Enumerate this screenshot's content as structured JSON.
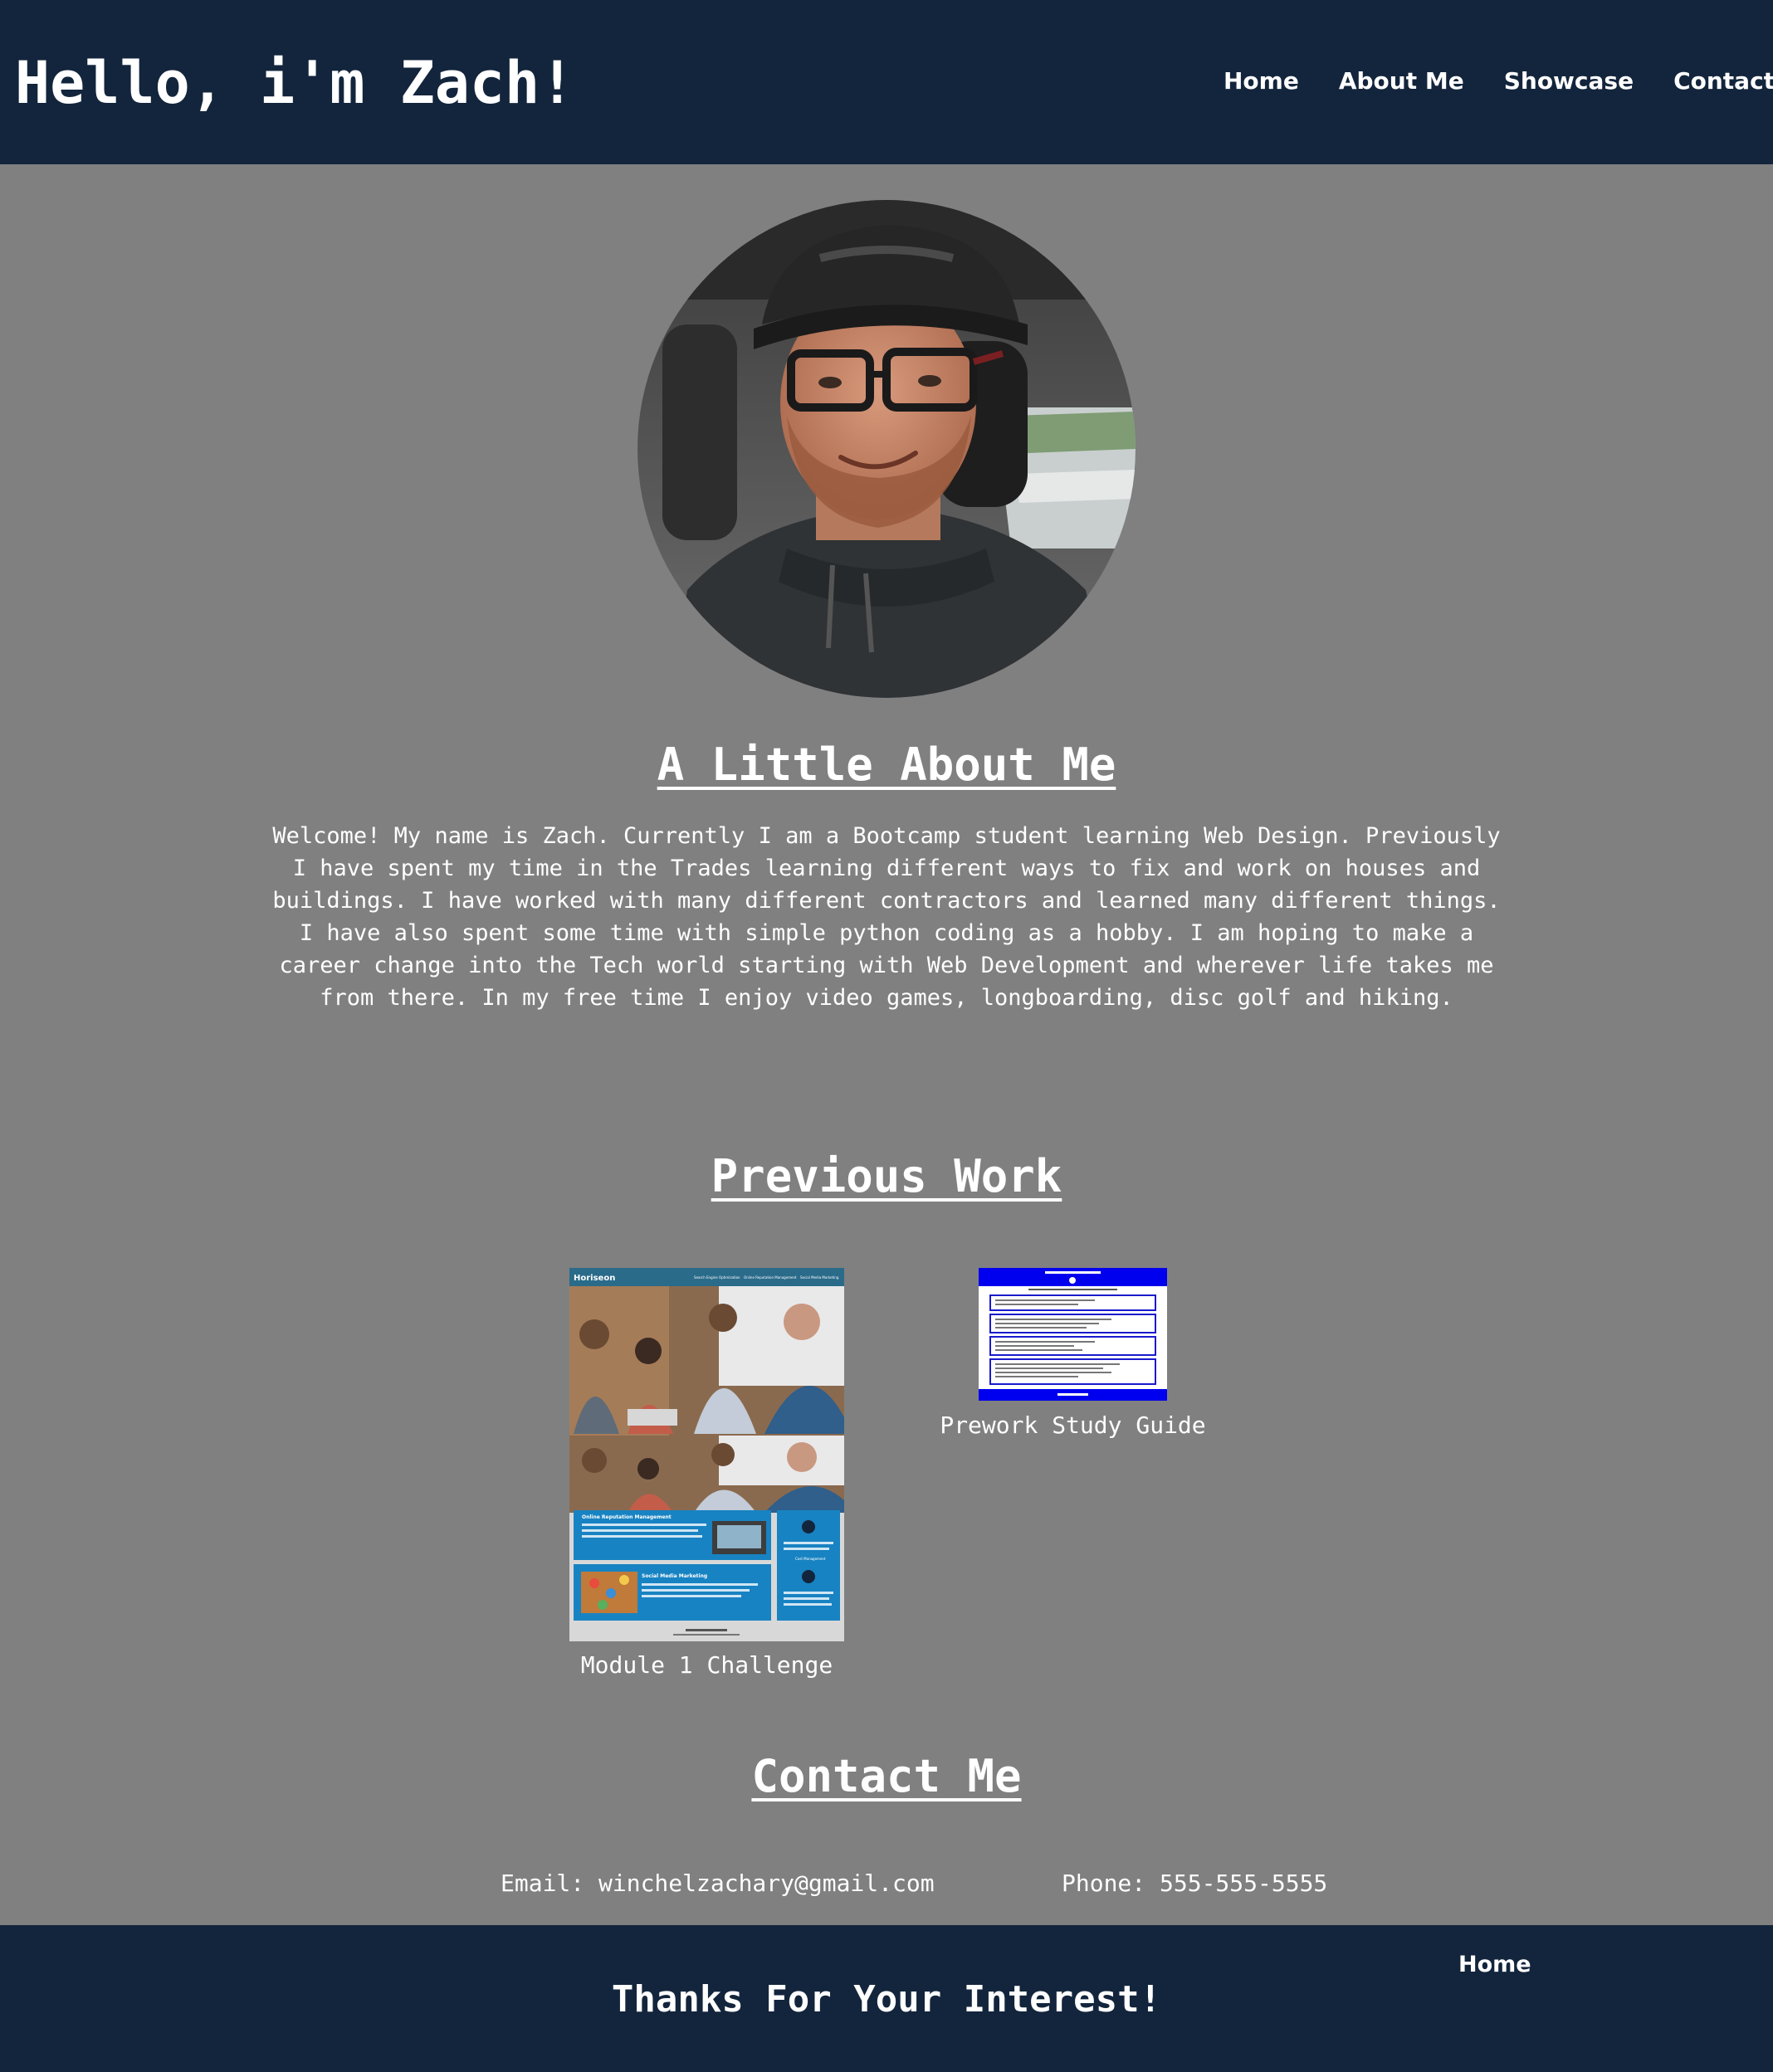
{
  "header": {
    "title": "Hello, i'm Zach!",
    "nav": [
      {
        "label": "Home"
      },
      {
        "label": "About Me"
      },
      {
        "label": "Showcase"
      },
      {
        "label": "Contact"
      }
    ]
  },
  "about": {
    "heading": "A Little About Me",
    "text": "Welcome! My name is Zach. Currently I am a Bootcamp student learning Web Design. Previously I have spent my time in the Trades learning different ways to fix and work on houses and buildings. I have worked with many different contractors and learned many different things. I have also spent some time with simple python coding as a hobby. I am hoping to make a career change into the Tech world starting with Web Development and wherever life takes me from there. In my free time I enjoy video games, longboarding, disc golf and hiking."
  },
  "work": {
    "heading": "Previous Work",
    "items": [
      {
        "caption": "Module 1 Challenge",
        "thumb": {
          "brand": "Horiseon",
          "nav": [
            "Search Engine Optimization",
            "Online Reputation Management",
            "Social Media Marketing"
          ],
          "card1_title": "Online Reputation Management",
          "card2_title": "Social Media Marketing",
          "side_label": "Cost Management"
        }
      },
      {
        "caption": "Prework Study Guide",
        "thumb": {}
      }
    ]
  },
  "contact": {
    "heading": "Contact Me",
    "email": "Email: winchelzachary@gmail.com",
    "phone": "Phone: 555-555-5555"
  },
  "footer": {
    "home_label": "Home",
    "message": "Thanks For Your Interest!"
  },
  "colors": {
    "page_background": "#808080",
    "header_background": "#13253c",
    "text": "#ffffff"
  },
  "icons": {
    "avatar": "profile-photo"
  }
}
